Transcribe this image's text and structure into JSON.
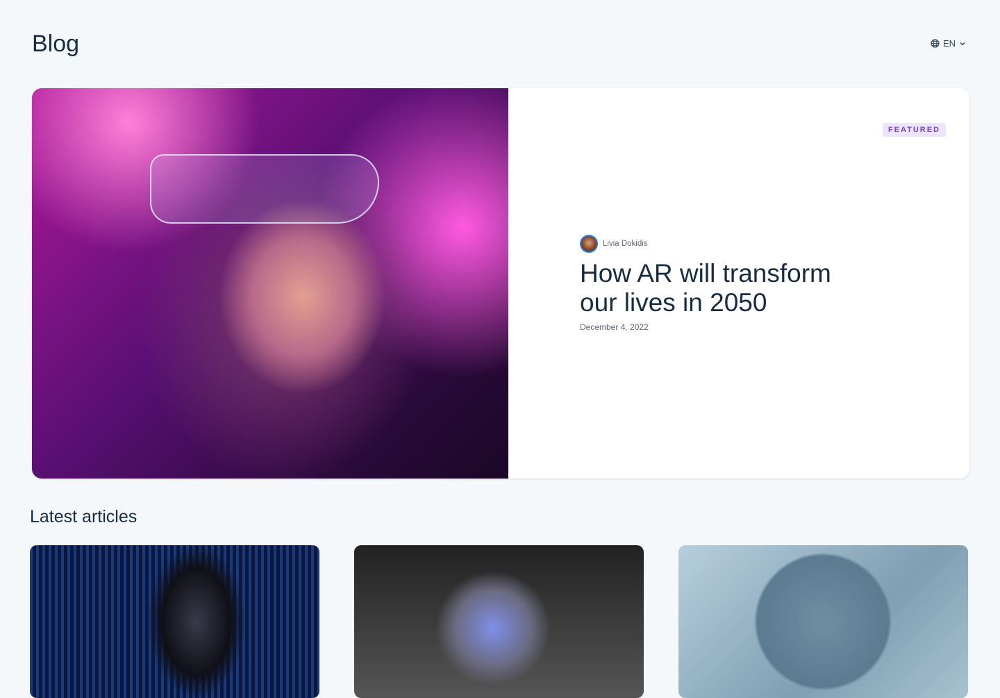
{
  "header": {
    "title": "Blog",
    "language": "EN",
    "language_icon": "globe-icon"
  },
  "featured": {
    "badge": "FEATURED",
    "author": "Livia Dokidis",
    "title": "How AR will transform our lives in 2050",
    "date": "December 4, 2022",
    "badge_color": "#7b3fe0"
  },
  "latest": {
    "heading": "Latest articles"
  }
}
